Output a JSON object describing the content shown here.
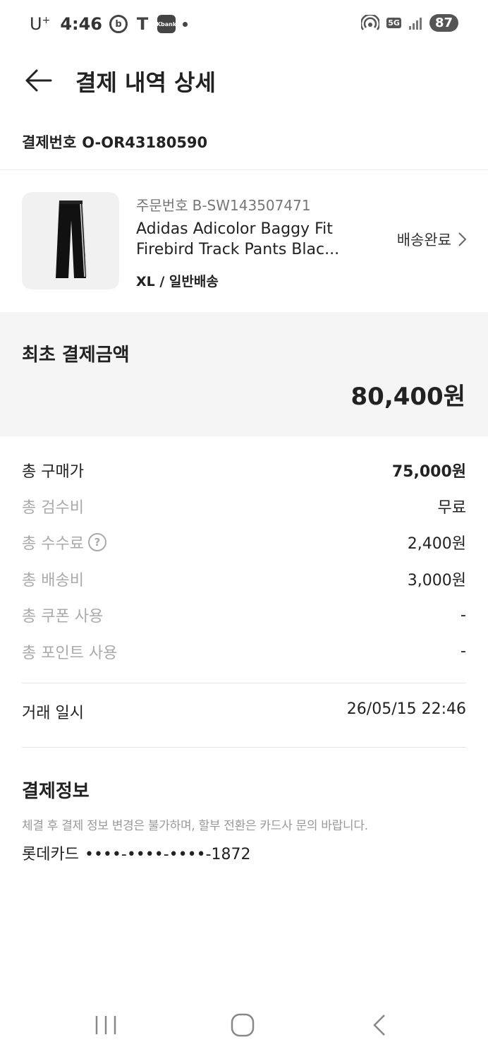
{
  "status_bar": {
    "carrier": "U",
    "carrier_sup": "+",
    "time": "4:46",
    "app_b": "b",
    "app_t": "T",
    "app_k": "Kbank",
    "network": "5G",
    "battery": "87"
  },
  "header": {
    "title": "결제 내역 상세"
  },
  "payment_number": {
    "label": "결제번호",
    "value": "O-OR43180590"
  },
  "product": {
    "order_label": "주문번호",
    "order_no": "B-SW143507471",
    "name_line1": "Adidas Adicolor Baggy Fit",
    "name_line2": "Firebird Track Pants Blac...",
    "option": "XL / 일반배송",
    "status": "배송완료"
  },
  "initial_payment": {
    "label": "최초 결제금액",
    "amount": "80,400원"
  },
  "breakdown": [
    {
      "label": "총 구매가",
      "value": "75,000원"
    },
    {
      "label": "총 검수비",
      "value": "무료"
    },
    {
      "label": "총 수수료",
      "value": "2,400원",
      "help": "?"
    },
    {
      "label": "총 배송비",
      "value": "3,000원"
    },
    {
      "label": "총 쿠폰 사용",
      "value": "-"
    },
    {
      "label": "총 포인트 사용",
      "value": "-"
    }
  ],
  "transaction": {
    "label": "거래 일시",
    "value": "26/05/15 22:46"
  },
  "payment_info": {
    "title": "결제정보",
    "note": "체결 후 결제 정보 변경은 불가하며, 할부 전환은 카드사 문의 바랍니다.",
    "card_name": "롯데카드",
    "card_number": "••••-••••-••••-1872"
  },
  "colors": {
    "text": "#222222",
    "muted": "#aaaaaa",
    "section_bg": "#f5f5f5"
  }
}
